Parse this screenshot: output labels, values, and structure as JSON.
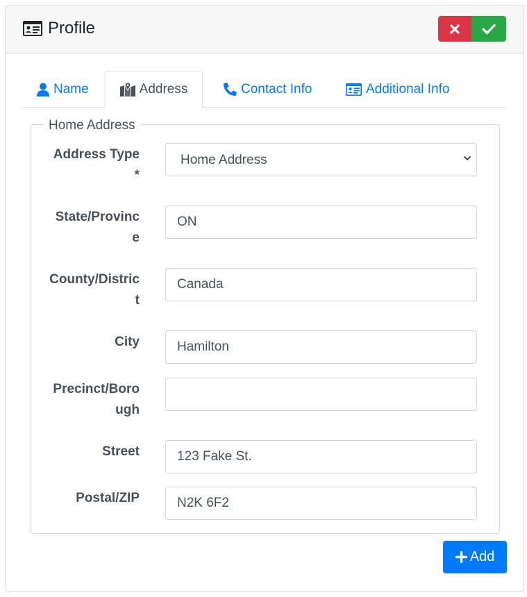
{
  "header": {
    "title": "Profile",
    "icon": "id-card-icon"
  },
  "tabs": [
    {
      "label": "Name",
      "icon": "user-icon",
      "active": false
    },
    {
      "label": "Address",
      "icon": "map-marked-icon",
      "active": true
    },
    {
      "label": "Contact Info",
      "icon": "phone-icon",
      "active": false
    },
    {
      "label": "Additional Info",
      "icon": "id-card-icon",
      "active": false
    }
  ],
  "address": {
    "legend": "Home Address",
    "fields": {
      "address_type": {
        "label": "Address Type*",
        "value": "Home Address",
        "options": [
          "Home Address"
        ]
      },
      "state": {
        "label": "State/Province",
        "value": "ON"
      },
      "county": {
        "label": "County/District",
        "value": "Canada"
      },
      "city": {
        "label": "City",
        "value": "Hamilton"
      },
      "precinct": {
        "label": "Precinct/Borough",
        "value": ""
      },
      "street": {
        "label": "Street",
        "value": "123 Fake St."
      },
      "postal": {
        "label": "Postal/ZIP",
        "value": "N2K 6F2"
      }
    }
  },
  "actions": {
    "add_label": "Add"
  },
  "colors": {
    "primary": "#007bff",
    "danger": "#dc3545",
    "success": "#28a745"
  }
}
